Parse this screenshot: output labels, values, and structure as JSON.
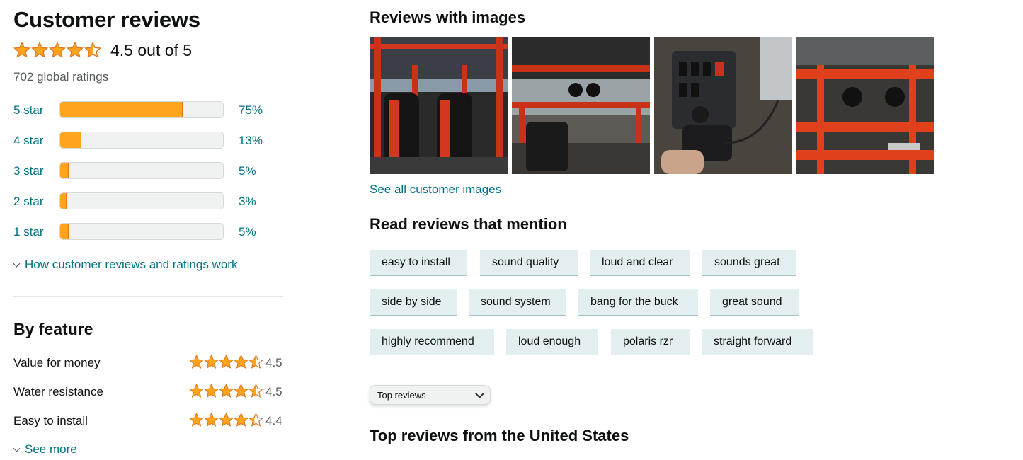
{
  "summary": {
    "title": "Customer reviews",
    "overall_rating": 4.5,
    "overall_text": "4.5 out of 5",
    "global_ratings": "702 global ratings"
  },
  "histogram": [
    {
      "label": "5 star",
      "percent": 75,
      "percent_text": "75%"
    },
    {
      "label": "4 star",
      "percent": 13,
      "percent_text": "13%"
    },
    {
      "label": "3 star",
      "percent": 5,
      "percent_text": "5%"
    },
    {
      "label": "2 star",
      "percent": 3,
      "percent_text": "3%"
    },
    {
      "label": "1 star",
      "percent": 5,
      "percent_text": "5%"
    }
  ],
  "how_link": "How customer reviews and ratings work",
  "by_feature": {
    "title": "By feature",
    "items": [
      {
        "name": "Value for money",
        "rating": 4.5,
        "rating_text": "4.5"
      },
      {
        "name": "Water resistance",
        "rating": 4.5,
        "rating_text": "4.5"
      },
      {
        "name": "Easy to install",
        "rating": 4.4,
        "rating_text": "4.4"
      }
    ],
    "see_more": "See more"
  },
  "images_section": {
    "title": "Reviews with images",
    "see_all": "See all customer images",
    "thumbnails": [
      "utv-cab-seats-photo",
      "utv-roll-cage-speakers-photo",
      "switch-panel-remote-photo",
      "red-roll-bar-speakers-photo"
    ]
  },
  "mentions": {
    "title": "Read reviews that mention",
    "chips": [
      [
        "easy to install",
        "sound quality",
        "loud and clear",
        "sounds great"
      ],
      [
        "side by side",
        "sound system",
        "bang for the buck",
        "great sound"
      ],
      [
        "highly recommend",
        "loud enough",
        "polaris rzr",
        "straight forward"
      ]
    ]
  },
  "sort": {
    "selected": "Top reviews"
  },
  "top_reviews_title": "Top reviews from the United States",
  "colors": {
    "star": "#ffa41c",
    "link": "#007185",
    "chip_bg": "#e3eef0"
  }
}
